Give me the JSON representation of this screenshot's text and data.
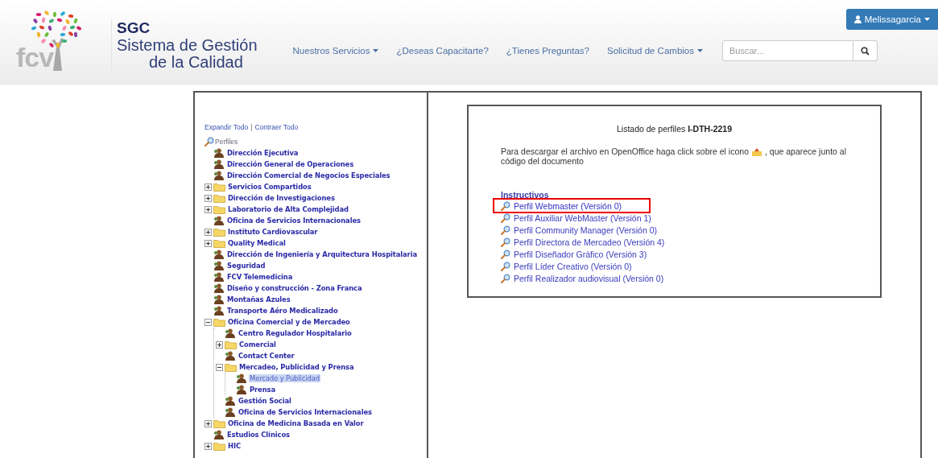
{
  "header": {
    "logo_text": "fcv",
    "app_short": "SGC",
    "app_title_line1": "Sistema de Gestión",
    "app_title_line2": "de la Calidad",
    "nav": [
      {
        "label": "Nuestros Servicios",
        "dropdown": true
      },
      {
        "label": "¿Deseas Capacitarte?",
        "dropdown": false
      },
      {
        "label": "¿Tienes Preguntas?",
        "dropdown": false
      },
      {
        "label": "Solicitud de Cambios",
        "dropdown": true
      }
    ],
    "search": {
      "placeholder": "Buscar..."
    },
    "user": {
      "name": "Melissagarcia"
    }
  },
  "tree": {
    "expand_all": "Expandir Todo",
    "separator": "|",
    "collapse_all": "Contraer Todo",
    "root": "Perfiles",
    "items": [
      {
        "kind": "profile",
        "label": "Dirección Ejecutiva",
        "selected": false
      },
      {
        "kind": "profile",
        "label": "Dirección General de Operaciones",
        "selected": false
      },
      {
        "kind": "profile",
        "label": "Dirección Comercial de Negocios Especiales",
        "selected": false
      },
      {
        "kind": "folder",
        "label": "Servicios Compartidos",
        "expanded": false,
        "selected": false
      },
      {
        "kind": "folder",
        "label": "Dirección de Investigaciones",
        "expanded": false,
        "selected": false
      },
      {
        "kind": "folder",
        "label": "Laboratorio de Alta Complejidad",
        "expanded": false,
        "selected": false
      },
      {
        "kind": "profile",
        "label": "Oficina de Servicios Internacionales",
        "selected": false
      },
      {
        "kind": "folder",
        "label": "Instituto Cardiovascular",
        "expanded": false,
        "selected": false
      },
      {
        "kind": "folder",
        "label": "Quality Medical",
        "expanded": false,
        "selected": false
      },
      {
        "kind": "profile",
        "label": "Dirección de Ingeniería y Arquitectura Hospitalaria",
        "selected": false
      },
      {
        "kind": "profile",
        "label": "Seguridad",
        "selected": false
      },
      {
        "kind": "profile",
        "label": "FCV Telemedicina",
        "selected": false
      },
      {
        "kind": "profile",
        "label": "Diseño y construcción - Zona Franca",
        "selected": false
      },
      {
        "kind": "profile",
        "label": "Montañas Azules",
        "selected": false
      },
      {
        "kind": "profile",
        "label": "Transporte Aéro Medicalizado",
        "selected": false
      },
      {
        "kind": "folder",
        "label": "Oficina Comercial y de Mercadeo",
        "expanded": true,
        "selected": false,
        "children": [
          {
            "kind": "profile",
            "label": "Centro Regulador Hospitalario",
            "selected": false
          },
          {
            "kind": "folder",
            "label": "Comercial",
            "expanded": false,
            "selected": false
          },
          {
            "kind": "profile",
            "label": "Contact Center",
            "selected": false
          },
          {
            "kind": "folder",
            "label": "Mercadeo, Publicidad y Prensa",
            "expanded": true,
            "selected": false,
            "children": [
              {
                "kind": "profile",
                "label": "Mercado y Publicidad",
                "selected": true
              },
              {
                "kind": "profile",
                "label": "Prensa",
                "selected": false
              }
            ]
          },
          {
            "kind": "profile",
            "label": "Gestión Social",
            "selected": false
          },
          {
            "kind": "profile",
            "label": "Oficina de Servicios Internacionales",
            "selected": false
          }
        ]
      },
      {
        "kind": "folder",
        "label": "Oficina de Medicina Basada en Valor",
        "expanded": false,
        "selected": false
      },
      {
        "kind": "profile",
        "label": "Estudios Clínicos",
        "selected": false
      },
      {
        "kind": "folder",
        "label": "HIC",
        "expanded": false,
        "selected": false
      }
    ]
  },
  "document": {
    "title": "Listado de perfiles **I-DTH-2219**",
    "text_before_icon": "Para descargar el archivo en OpenOffice haga click sobre el icono",
    "text_after_icon": ", que aparece junto al",
    "text_second_line": "código del documento",
    "section": "Instructivos",
    "links": [
      {
        "label": "Perfil Webmaster (Versión 0)",
        "highlighted": true
      },
      {
        "label": "Perfil Auxiliar WebMaster (Versión 1)",
        "highlighted": false
      },
      {
        "label": "Perfil Community Manager (Versión 0)",
        "highlighted": false
      },
      {
        "label": "Perfil Directora de Mercadeo (Versión 4)",
        "highlighted": false
      },
      {
        "label": "Perfil Diseñador Gráfico (Versión 3)",
        "highlighted": false
      },
      {
        "label": "Perfil Líder Creativo (Versión 0)",
        "highlighted": false
      },
      {
        "label": "Perfil Realizador audiovisual (Versión 0)",
        "highlighted": false
      }
    ]
  }
}
